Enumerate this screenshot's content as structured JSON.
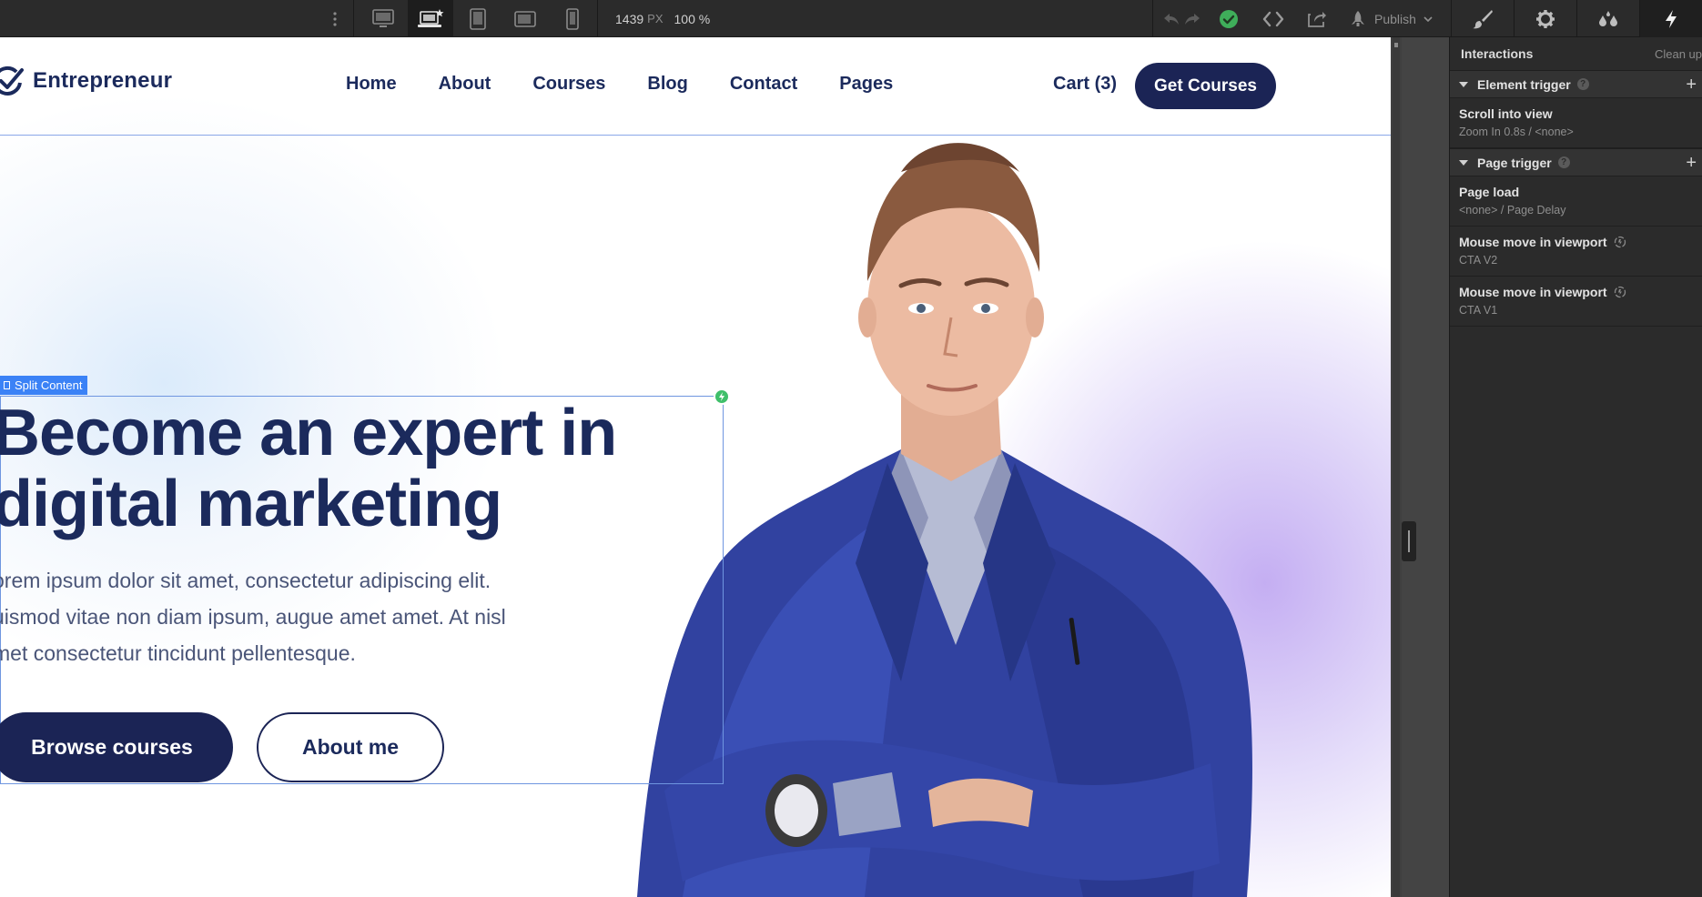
{
  "toolbar": {
    "width_value": "1439",
    "width_unit": "PX",
    "zoom": "100 %",
    "publish_label": "Publish"
  },
  "site": {
    "logo_text": "Entrepreneur",
    "nav": [
      {
        "label": "Home"
      },
      {
        "label": "About"
      },
      {
        "label": "Courses"
      },
      {
        "label": "Blog"
      },
      {
        "label": "Contact"
      },
      {
        "label": "Pages"
      }
    ],
    "cart": "Cart (3)",
    "cta": "Get Courses",
    "selection_tag": "Split Content",
    "hero": {
      "title_line1": "Become an expert in",
      "title_line2": "digital marketing",
      "sub_line1": "orem ipsum dolor sit amet, consectetur adipiscing elit.",
      "sub_line2": "uismod vitae non diam ipsum, augue amet amet. At nisl",
      "sub_line3": "met consectetur tincidunt pellentesque.",
      "btn_primary": "Browse courses",
      "btn_secondary": "About me"
    }
  },
  "panel": {
    "title": "Interactions",
    "clean_up": "Clean up",
    "element_trigger": {
      "label": "Element trigger",
      "items": [
        {
          "title": "Scroll into view",
          "sub": "Zoom In 0.8s / <none>"
        }
      ]
    },
    "page_trigger": {
      "label": "Page trigger",
      "items": [
        {
          "title": "Page load",
          "sub": "<none> / Page Delay"
        },
        {
          "title": "Mouse move in viewport",
          "sub": "CTA V2"
        },
        {
          "title": "Mouse move in viewport",
          "sub": "CTA V1"
        }
      ]
    }
  },
  "colors": {
    "brand_navy": "#1b2455",
    "heading": "#1b2a5c",
    "selection_blue": "#3b82f6",
    "status_green": "#3fbf6a",
    "editor_bg": "#2b2b2b"
  },
  "icons": [
    "more-vertical-icon",
    "desktop-icon",
    "laptop-star-icon",
    "tablet-icon",
    "tablet-landscape-icon",
    "phone-icon",
    "undo-icon",
    "redo-icon",
    "check-circle-icon",
    "code-icon",
    "export-icon",
    "rocket-icon",
    "chevron-down-icon",
    "brush-icon",
    "gear-icon",
    "drops-icon",
    "lightning-icon",
    "checkmark-logo-icon",
    "loop-icon",
    "help-icon",
    "plus-icon"
  ]
}
